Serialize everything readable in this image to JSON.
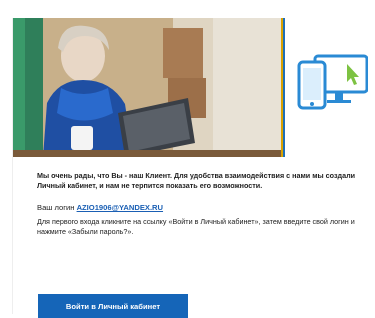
{
  "email": {
    "intro": "Мы очень рады, что Вы - наш Клиент. Для удобства взаимодействия с нами мы создали Личный кабинет, и нам не терпится показать его возможности.",
    "login_prefix": "Ваш логин",
    "login_value": "AZIO1906@YANDEX.RU",
    "instructions": "Для первого входа кликните на ссылку «Войти в Личный кабинет», затем введите свой логин и нажмите «Забыли пароль?».",
    "cta_label": "Войти в Личный кабинет"
  },
  "icons": {
    "banner_photo": "woman-with-laptop-photo",
    "devices": "devices-with-cursor-icon"
  },
  "colors": {
    "accent": "#1565b8",
    "banner_blue": "#1d6fb8",
    "banner_gold": "#d9a200",
    "icon_green": "#7dc242"
  }
}
